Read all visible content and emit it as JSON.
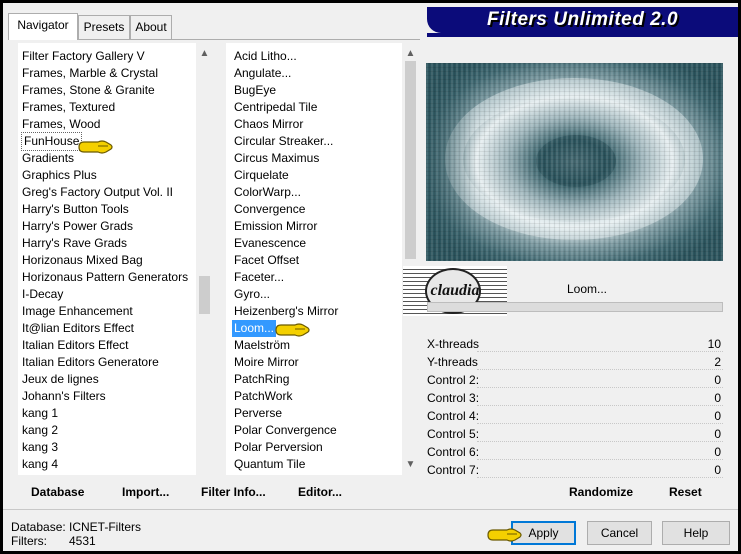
{
  "window": {
    "title": "Filters Unlimited 2.0"
  },
  "tabs": [
    {
      "label": "Navigator",
      "active": true
    },
    {
      "label": "Presets",
      "active": false
    },
    {
      "label": "About",
      "active": false
    }
  ],
  "categories": {
    "items": [
      "Filter Factory Gallery V",
      "Frames, Marble & Crystal",
      "Frames, Stone & Granite",
      "Frames, Textured",
      "Frames, Wood",
      "FunHouse",
      "Gradients",
      "Graphics Plus",
      "Greg's Factory Output Vol. II",
      "Harry's Button Tools",
      "Harry's Power Grads",
      "Harry's Rave Grads",
      "Horizonaus Mixed Bag",
      "Horizonaus Pattern Generators",
      "I-Decay",
      "Image Enhancement",
      "It@lian Editors Effect",
      "Italian Editors Effect",
      "Italian Editors Generatore",
      "Jeux de lignes",
      "Johann's Filters",
      "kang 1",
      "kang 2",
      "kang 3",
      "kang 4"
    ],
    "selected": "FunHouse"
  },
  "filters": {
    "items": [
      "Acid Litho...",
      "Angulate...",
      "BugEye",
      "Centripedal Tile",
      "Chaos Mirror",
      "Circular Streaker...",
      "Circus Maximus",
      "Cirquelate",
      "ColorWarp...",
      "Convergence",
      "Emission Mirror",
      "Evanescence",
      "Facet Offset",
      "Faceter...",
      "Gyro...",
      "Heizenberg's Mirror",
      "Loom...",
      "Maelström",
      "Moire Mirror",
      "PatchRing",
      "PatchWork",
      "Perverse",
      "Polar Convergence",
      "Polar Perversion",
      "Quantum Tile"
    ],
    "selected": "Loom..."
  },
  "watermark": {
    "text": "claudia"
  },
  "filter_name": "Loom...",
  "params": [
    {
      "label": "X-threads",
      "value": "10"
    },
    {
      "label": "Y-threads",
      "value": "2"
    },
    {
      "label": "Control 2:",
      "value": "0"
    },
    {
      "label": "Control 3:",
      "value": "0"
    },
    {
      "label": "Control 4:",
      "value": "0"
    },
    {
      "label": "Control 5:",
      "value": "0"
    },
    {
      "label": "Control 6:",
      "value": "0"
    },
    {
      "label": "Control 7:",
      "value": "0"
    }
  ],
  "actions": {
    "database": "Database",
    "import": "Import...",
    "filter_info": "Filter Info...",
    "editor": "Editor...",
    "randomize": "Randomize",
    "reset": "Reset"
  },
  "status": {
    "database_label": "Database:",
    "database_value": "ICNET-Filters",
    "filters_label": "Filters:",
    "filters_value": "4531"
  },
  "buttons": {
    "apply": "Apply",
    "cancel": "Cancel",
    "help": "Help"
  },
  "colors": {
    "accent": "#0078d7",
    "banner": "#0b0b7a",
    "selection": "#3399ff",
    "pointer": "#f4d000"
  }
}
